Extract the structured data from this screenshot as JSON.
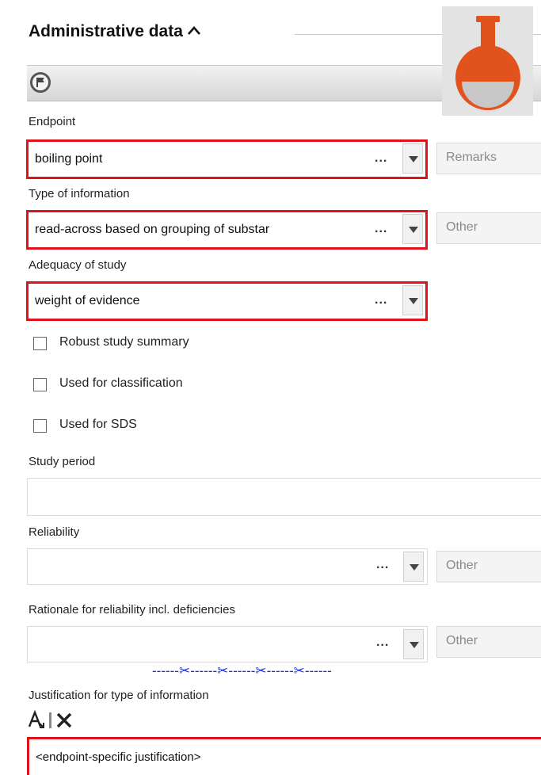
{
  "section": {
    "title": "Administrative data",
    "collapse_icon": "chevron-up-icon"
  },
  "toolbar": {
    "flag_icon": "flag-icon"
  },
  "logo": {
    "icon": "flask-icon",
    "color": "#e2521d"
  },
  "fields": {
    "endpoint": {
      "label": "Endpoint",
      "value": "boiling point",
      "ellipsis": "...",
      "side_placeholder": "Remarks"
    },
    "type_of_information": {
      "label": "Type of information",
      "value": "read-across based on grouping of substar",
      "ellipsis": "...",
      "side_placeholder": "Other"
    },
    "adequacy_of_study": {
      "label": "Adequacy of study",
      "value": "weight of evidence",
      "ellipsis": "..."
    },
    "study_period": {
      "label": "Study period",
      "value": ""
    },
    "reliability": {
      "label": "Reliability",
      "value": "",
      "ellipsis": "...",
      "side_placeholder": "Other"
    },
    "rationale": {
      "label": "Rationale for reliability incl. deficiencies",
      "value": "",
      "ellipsis": "...",
      "side_placeholder": "Other"
    },
    "justification": {
      "label": "Justification for type of information",
      "value": "<endpoint-specific justification>"
    }
  },
  "checkboxes": [
    {
      "label": "Robust study summary",
      "checked": false
    },
    {
      "label": "Used for classification",
      "checked": false
    },
    {
      "label": "Used for SDS",
      "checked": false
    }
  ],
  "separator_text": "------✂------✂------✂------✂------",
  "editor_tools": {
    "format_icon": "text-format-icon",
    "clear_icon": "clear-x-icon"
  },
  "colors": {
    "required_border": "#e0121a",
    "separator": "#1a2de6"
  }
}
